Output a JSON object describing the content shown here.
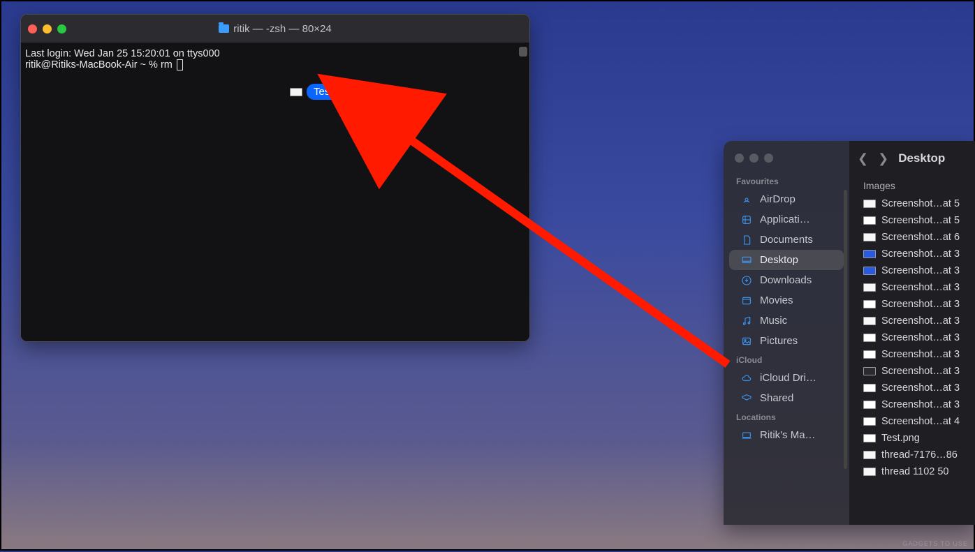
{
  "terminal": {
    "title": "ritik — -zsh — 80×24",
    "line1": "Last login: Wed Jan 25 15:20:01 on ttys000",
    "prompt": "ritik@Ritiks-MacBook-Air ~ % rm ",
    "drag_file_label": "Test.png"
  },
  "finder": {
    "breadcrumb": "Desktop",
    "list_header": "Images",
    "sections": {
      "favourites_label": "Favourites",
      "icloud_label": "iCloud",
      "locations_label": "Locations"
    },
    "sidebar": {
      "favourites": [
        {
          "icon": "airdrop",
          "label": "AirDrop"
        },
        {
          "icon": "apps",
          "label": "Applicati…"
        },
        {
          "icon": "doc",
          "label": "Documents"
        },
        {
          "icon": "desktop",
          "label": "Desktop"
        },
        {
          "icon": "download",
          "label": "Downloads"
        },
        {
          "icon": "movies",
          "label": "Movies"
        },
        {
          "icon": "music",
          "label": "Music"
        },
        {
          "icon": "pictures",
          "label": "Pictures"
        }
      ],
      "icloud": [
        {
          "icon": "cloud",
          "label": "iCloud Dri…"
        },
        {
          "icon": "shared",
          "label": "Shared"
        }
      ],
      "locations": [
        {
          "icon": "laptop",
          "label": "Ritik's Ma…"
        }
      ]
    },
    "files": [
      "Screenshot…at 5",
      "Screenshot…at 5",
      "Screenshot…at 6",
      "Screenshot…at 3",
      "Screenshot…at 3",
      "Screenshot…at 3",
      "Screenshot…at 3",
      "Screenshot…at 3",
      "Screenshot…at 3",
      "Screenshot…at 3",
      "Screenshot…at 3",
      "Screenshot…at 3",
      "Screenshot…at 3",
      "Screenshot…at 4",
      "Test.png",
      "thread-7176…86",
      "thread 1102  50"
    ]
  },
  "watermark": "GADGETS TO USE"
}
